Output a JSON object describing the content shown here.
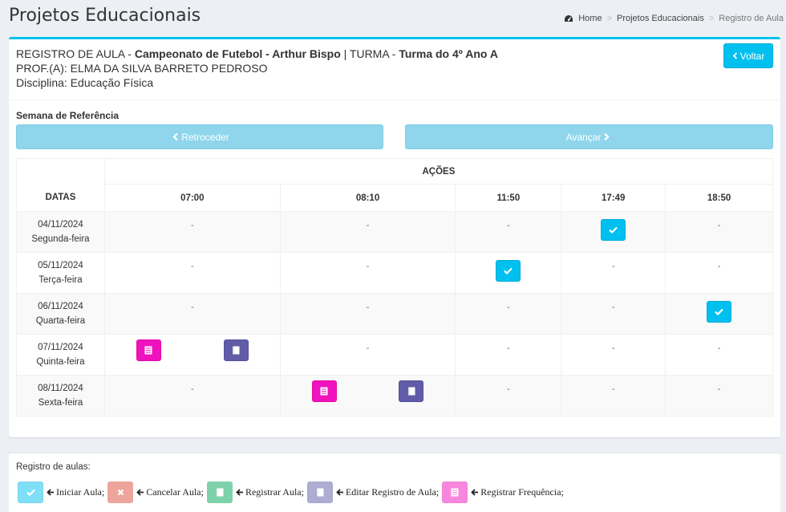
{
  "page": {
    "title": "Projetos Educacionais",
    "breadcrumb": [
      "Home",
      "Projetos Educacionais",
      "Registro de Aula"
    ]
  },
  "header": {
    "prefix": "REGISTRO DE AULA - ",
    "project": "Campeonato de Futebol - Arthur Bispo",
    "separator": " | TURMA - ",
    "class_name": "Turma do 4º Ano A",
    "teacher": "PROF.(A): ELMA DA SILVA BARRETO PEDROSO",
    "discipline": "Disciplina: Educação Física",
    "back_label": "Voltar"
  },
  "week": {
    "label": "Semana de Referência",
    "prev_label": "Retroceder",
    "next_label": "Avançar"
  },
  "table": {
    "actions_header": "AÇÕES",
    "dates_header": "DATAS",
    "times": [
      "07:00",
      "08:10",
      "11:50",
      "17:49",
      "18:50"
    ],
    "empty_cell": "-",
    "rows": [
      {
        "date": "04/11/2024",
        "weekday": "Segunda-feira"
      },
      {
        "date": "05/11/2024",
        "weekday": "Terça-feira"
      },
      {
        "date": "06/11/2024",
        "weekday": "Quarta-feira"
      },
      {
        "date": "07/11/2024",
        "weekday": "Quinta-feira"
      },
      {
        "date": "08/11/2024",
        "weekday": "Sexta-feira"
      }
    ]
  },
  "legend": {
    "title": "Registro de aulas:",
    "items": [
      "Iniciar Aula;",
      "Cancelar Aula;",
      "Registrar Aula;",
      "Editar Registro de Aula;",
      "Registrar Frequência;"
    ]
  },
  "colors": {
    "info": "#00c0ef",
    "danger": "#dd4b39",
    "success": "#00a65a",
    "purple": "#605ca8",
    "fuchsia": "#f012be"
  }
}
